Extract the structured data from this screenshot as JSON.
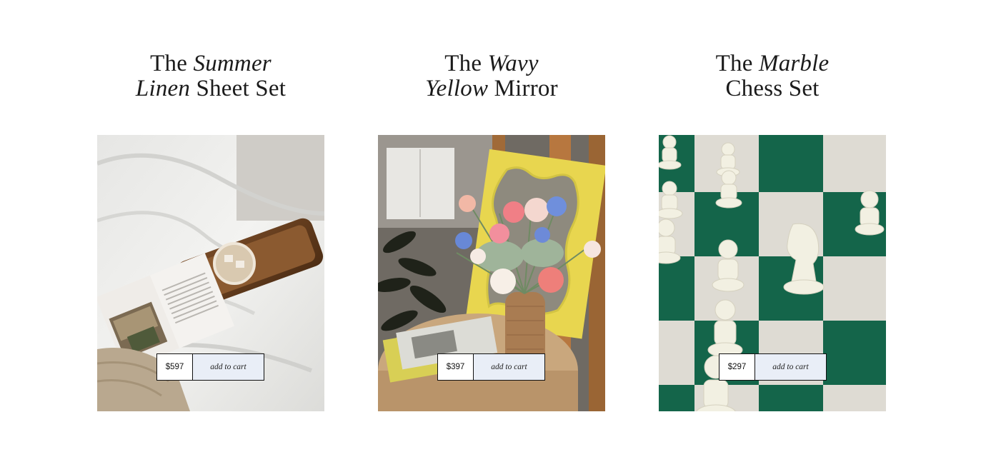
{
  "products": [
    {
      "title_prefix": "The ",
      "title_italic_1": "Summer",
      "title_italic_2": "Linen",
      "title_suffix": " Sheet Set",
      "image": "bed-linen-tray-coffee-book",
      "price": "$597",
      "cta": "add to cart"
    },
    {
      "title_prefix": "The ",
      "title_italic_1": "Wavy",
      "title_italic_2": "Yellow",
      "title_suffix": " Mirror",
      "image": "yellow-wavy-mirror-flowers",
      "price": "$397",
      "cta": "add to cart"
    },
    {
      "title_prefix": "The ",
      "title_italic_1": "Marble",
      "title_italic_2": "",
      "title_suffix": "Chess Set",
      "image": "green-chessboard-white-pieces",
      "price": "$297",
      "cta": "add to cart"
    }
  ],
  "colors": {
    "button_fill": "#e9eef7",
    "chess_green": "#14654a",
    "mirror_yellow": "#e8d64f"
  }
}
